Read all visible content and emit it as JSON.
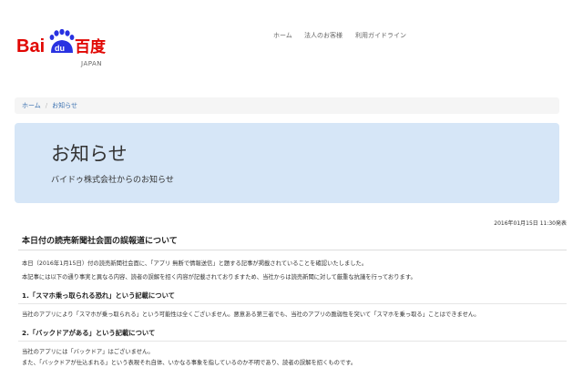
{
  "logo": {
    "text": "Baidu百度",
    "sub": "JAPAN",
    "colors": {
      "red": "#e10602",
      "blue": "#2932e1"
    }
  },
  "nav": {
    "items": [
      "ホーム",
      "法人のお客様",
      "利用ガイドライン"
    ]
  },
  "breadcrumb": {
    "home": "ホーム",
    "separator": "/",
    "current": "お知らせ"
  },
  "hero": {
    "title": "お知らせ",
    "subtitle": "バイドゥ株式会社からのお知らせ",
    "bg": "#d6e6f7"
  },
  "article": {
    "date": "2016年01月15日 11:30発表",
    "title": "本日付の読売新聞社会面の誤報道について",
    "intro1": "本日（2016年1月15日）付の読売新聞社会面に、「アプリ 無断で情報送信」と題する記事が掲載されていることを確認いたしました。",
    "intro2": "本記事には以下の通り事実と異なる内容、読者の誤解を招く内容が記載されておりますため、当社からは読売新聞に対して厳重な抗議を行っております。",
    "section1": {
      "heading": "1.「スマホ乗っ取られる恐れ」という記載について",
      "body": "当社のアプリにより「スマホが乗っ取られる」という可能性は全くございません。悪意ある第三者でも、当社のアプリの脆弱性を突いて「スマホを乗っ取る」ことはできません。"
    },
    "section2": {
      "heading": "2.「バックドアがある」という記載について",
      "body1": "当社のアプリには「バックドア」はございません。",
      "body2": "また、「バックドアが仕込まれる」という表現それ自体、いかなる事象を指しているのか不明であり、読者の誤解を招くものです。"
    }
  }
}
